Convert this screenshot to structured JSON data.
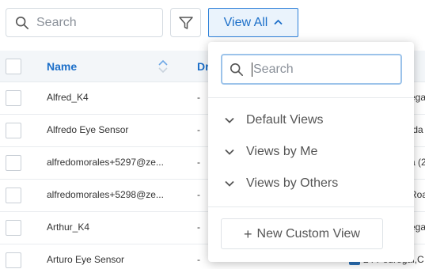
{
  "toolbar": {
    "search_placeholder": "Search",
    "view_all_label": "View All",
    "view_all_caret": "⌃"
  },
  "table": {
    "columns": {
      "name": "Name",
      "second_partial": "Dr"
    },
    "rows": [
      {
        "name": "Alfred_K4",
        "col2": "-",
        "right": "ega"
      },
      {
        "name": "Alfredo Eye Sensor",
        "col2": "-",
        "right": "ıda"
      },
      {
        "name": "alfredomorales+5297@ze...",
        "col2": "-",
        "right": "a (2"
      },
      {
        "name": "alfredomorales+5298@ze...",
        "col2": "-",
        "right": "Roa"
      },
      {
        "name": "Arthur_K4",
        "col2": "-",
        "right": "ega"
      },
      {
        "name": "Arturo Eye Sensor",
        "col2": "-",
        "right": "24 Pedregal,C"
      }
    ]
  },
  "dropdown": {
    "search_placeholder": "Search",
    "groups": [
      {
        "label": "Default Views"
      },
      {
        "label": "Views by Me"
      },
      {
        "label": "Views by Others"
      }
    ],
    "new_view_label": "New Custom View",
    "new_view_icon": "+"
  },
  "colors": {
    "accent": "#1c6fc9",
    "accent_bg": "#eaf3fc",
    "header_bg": "#f3f6f9"
  }
}
